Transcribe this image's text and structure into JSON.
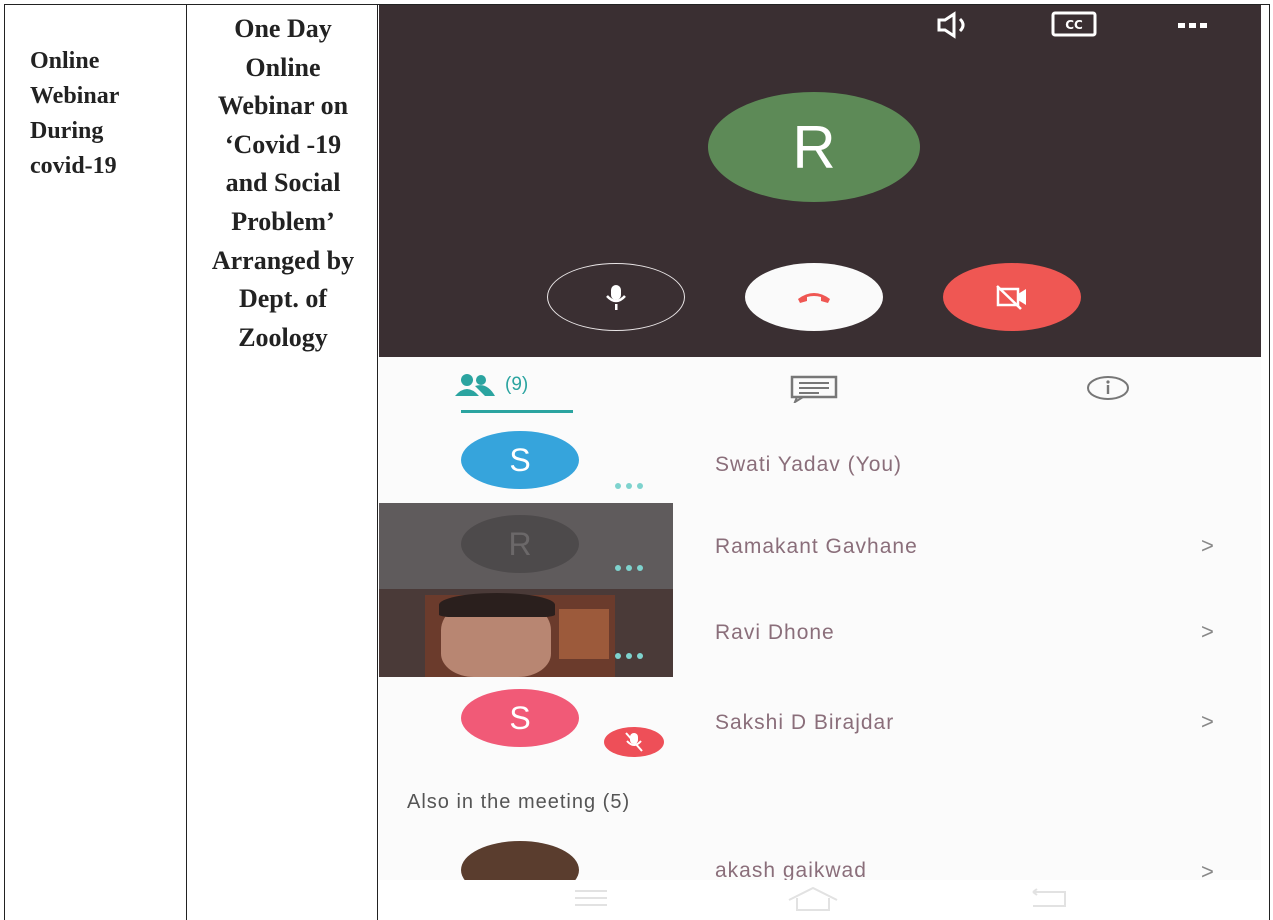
{
  "document": {
    "event_cell": "Online Webinar During covid-19",
    "title_cell": "One Day\nOnline\nWebinar on\n‘Covid -19\nand Social\nProblem’\nArranged by\nDept. of\nZoology"
  },
  "meeting": {
    "video": {
      "main_avatar_initial": "R",
      "main_avatar_color": "#5d8a57",
      "background_color": "#3a2f32",
      "icons": [
        "speaker-icon",
        "closed-captions-icon",
        "more-options-icon"
      ],
      "controls": [
        "microphone-icon",
        "hang-up-icon",
        "camera-off-icon"
      ],
      "hangup_color": "#ef5753"
    },
    "tabs": {
      "participants_count": "(9)",
      "accent_color": "#2ba4a0",
      "icons": [
        "people-icon",
        "chat-icon",
        "info-icon"
      ]
    },
    "participants": [
      {
        "name": "Swati Yadav (You)",
        "initial": "S",
        "avatar_color": "#36a4dc"
      },
      {
        "name": "Ramakant Gavhane",
        "initial": "R",
        "avatar_color": "#4d4a4b",
        "chevron": ">"
      },
      {
        "name": "Ravi Dhone",
        "chevron": ">"
      },
      {
        "name": "Sakshi D Birajdar",
        "initial": "S",
        "avatar_color": "#f15a77",
        "chevron": ">",
        "muted": true
      }
    ],
    "also_in_meeting": "Also in the meeting (5)",
    "partial_participant": {
      "name": "akash gaikwad",
      "chevron": ">"
    }
  }
}
